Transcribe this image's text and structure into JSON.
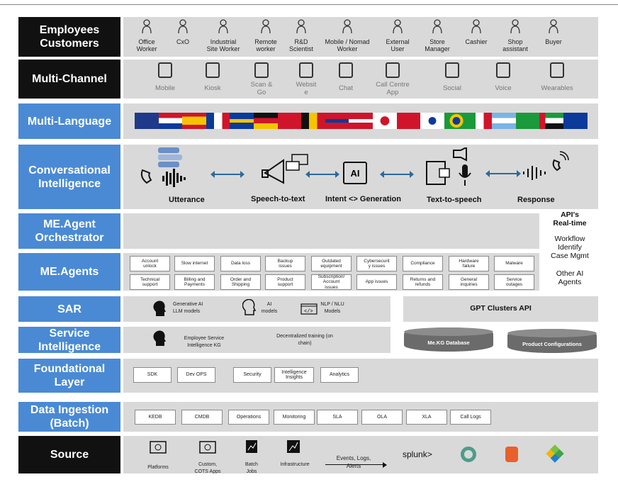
{
  "layers": {
    "employees": [
      "Employees",
      "Customers"
    ],
    "multichannel": "Multi-Channel",
    "multilanguage": "Multi-Language",
    "conv": [
      "Conversational",
      "Intelligence"
    ],
    "orch": [
      "ME.Agent",
      "Orchestrator"
    ],
    "agents": "ME.Agents",
    "sar": "SAR",
    "service": [
      "Service",
      "Intelligence"
    ],
    "foundational": [
      "Foundational",
      "Layer"
    ],
    "ingestion": [
      "Data Ingestion",
      "(Batch)"
    ],
    "source": "Source"
  },
  "personas": [
    [
      "Office",
      "Worker"
    ],
    [
      "CxO",
      ""
    ],
    [
      "Industrial",
      "Site Worker"
    ],
    [
      "Remote",
      "worker"
    ],
    [
      "R&D",
      "Scientist"
    ],
    [
      "Mobile / Nomad",
      "Worker"
    ],
    [
      "External",
      "User"
    ],
    [
      "Store",
      "Manager"
    ],
    [
      "Cashier",
      ""
    ],
    [
      "Shop",
      "assistant"
    ],
    [
      "Buyer",
      ""
    ]
  ],
  "channels": [
    [
      "Mobile",
      ""
    ],
    [
      "Kiosk",
      ""
    ],
    [
      "Scan &",
      "Go"
    ],
    [
      "Websit",
      "e"
    ],
    [
      "Chat",
      ""
    ],
    [
      "Call Centre",
      "App"
    ],
    [
      "Social",
      ""
    ],
    [
      "Voice",
      ""
    ],
    [
      "Wearables",
      ""
    ]
  ],
  "flag_colors": {
    "uk": "#1f3a8a",
    "red": "#d0152b",
    "blue": "#0b3a9a",
    "yellow": "#f5c400",
    "black": "#111111",
    "green": "#1a9a3a",
    "white": "#ffffff"
  },
  "conv": {
    "steps": [
      "Utterance",
      "Speech-to-text",
      "Intent <> Generation",
      "Text-to-speech",
      "Response"
    ],
    "ai_chip": "AI"
  },
  "api_panel": {
    "title": [
      "API's",
      "Real-time"
    ],
    "items": [
      "Workflow",
      "Identify",
      "Case Mgmt",
      "",
      "Other AI",
      "Agents"
    ]
  },
  "agents_row1": [
    [
      "Account",
      "unlock"
    ],
    [
      "Slow internet",
      ""
    ],
    [
      "Data loss",
      ""
    ],
    [
      "Backup",
      "issues"
    ],
    [
      "Outdated",
      "equipment"
    ],
    [
      "Cybersecurit",
      "y issues"
    ],
    [
      "Compliance",
      ""
    ],
    [
      "Hardware",
      "failure"
    ],
    [
      "Malware",
      ""
    ]
  ],
  "agents_row2": [
    [
      "Technical",
      "support"
    ],
    [
      "Billing and",
      "Payments"
    ],
    [
      "Order and",
      "Shipping"
    ],
    [
      "Product",
      "support"
    ],
    [
      "Subscription/",
      "Account",
      "issues"
    ],
    [
      "App issues",
      ""
    ],
    [
      "Returns and",
      "refunds"
    ],
    [
      "General",
      "inquiries"
    ],
    [
      "Service",
      "outages"
    ]
  ],
  "sar": {
    "items": [
      [
        "Generative AI",
        "LLM models"
      ],
      [
        "AI",
        "models"
      ],
      [
        "NLP / NLU",
        "Models"
      ]
    ],
    "gpt": "GPT Clusters API"
  },
  "service": {
    "kg": [
      "Employee Service",
      "Intelligence KG"
    ],
    "training": [
      "Decentralized training (on",
      "chain)"
    ],
    "db1": "Me.KG Database",
    "db2": "Product Configurations"
  },
  "foundational": [
    "SDK",
    "Dev OPS",
    "Security",
    "Intelligence Insights",
    "Analytics"
  ],
  "ingestion": [
    "KEDB",
    "CMDB",
    "Operations",
    "Monitoring",
    "SLA",
    "OLA",
    "XLA",
    "Call Logs"
  ],
  "source": {
    "items": [
      [
        "Platforms",
        ""
      ],
      [
        "Custom,",
        "COTS Apps"
      ],
      [
        "Batch",
        "Jobs"
      ],
      [
        "Infrastructure",
        ""
      ]
    ],
    "events": [
      "Events, Logs,",
      "Alerts"
    ],
    "splunk": "splunk>"
  }
}
